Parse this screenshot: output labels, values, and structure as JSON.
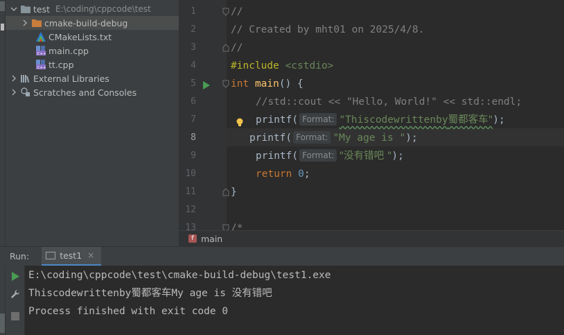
{
  "project": {
    "root": {
      "name": "test",
      "path": "E:\\coding\\cppcode\\test"
    },
    "items": [
      {
        "label": "cmake-build-debug",
        "icon": "folder-icon"
      },
      {
        "label": "CMakeLists.txt",
        "icon": "cmake-icon"
      },
      {
        "label": "main.cpp",
        "icon": "cpp-file-icon"
      },
      {
        "label": "tt.cpp",
        "icon": "cpp-file-icon"
      },
      {
        "label": "External Libraries",
        "icon": "libraries-icon"
      },
      {
        "label": "Scratches and Consoles",
        "icon": "scratches-icon"
      }
    ]
  },
  "editor": {
    "line_numbers": [
      "1",
      "2",
      "3",
      "4",
      "5",
      "6",
      "7",
      "8",
      "9",
      "10",
      "11",
      "12",
      "13"
    ],
    "current_line": "8",
    "code": {
      "l1": "//",
      "l2": "// Created by mht01 on 2025/4/8.",
      "l3": "//",
      "l4_directive": "#include",
      "l4_header": "<cstdio>",
      "l5_kw": "int",
      "l5_fn": "main",
      "l5_rest": "() {",
      "l6": "//std::cout << \"Hello, World!\" << std::endl;",
      "l7_call": "printf(",
      "l7_hint": "Format:",
      "l7_str_a": "\"Thiscodewrittenby",
      "l7_str_b": "蜀都客车\"",
      "l7_end": ");",
      "l8_call": "printf(",
      "l8_hint": "Format:",
      "l8_str": "\"My age is \"",
      "l8_end": ");",
      "l9_call": "printf(",
      "l9_hint": "Format:",
      "l9_str": "\"没有错吧 \"",
      "l9_end": ");",
      "l10_kw": "return",
      "l10_num": "0",
      "l10_end": ";",
      "l11": "}",
      "l13": "/*"
    }
  },
  "breadcrumb": {
    "function": "main",
    "badge": "f"
  },
  "run": {
    "title": "Run:",
    "tab": "test1",
    "close": "×",
    "output": [
      "E:\\coding\\cppcode\\test\\cmake-build-debug\\test1.exe",
      "Thiscodewrittenby蜀都客车My age is 没有错吧",
      "Process finished with exit code 0"
    ]
  },
  "colors": {
    "accent": "#4a88c7",
    "run_green": "#499c54",
    "keyword": "#cc7832",
    "string": "#6a8759"
  }
}
